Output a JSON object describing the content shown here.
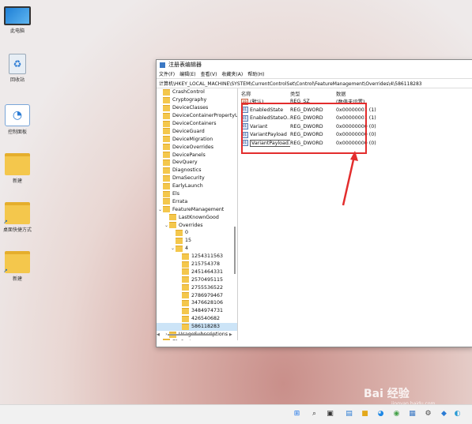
{
  "desktop_icons": [
    {
      "label": "此电脑",
      "kind": "monitor"
    },
    {
      "label": "回收站",
      "kind": "bin"
    },
    {
      "label": "控制面板",
      "kind": "cpanel"
    },
    {
      "label": "新建",
      "kind": "folder"
    },
    {
      "label": "桌面快捷方式",
      "kind": "folder"
    },
    {
      "label": "新建",
      "kind": "folder"
    }
  ],
  "window": {
    "title": "注册表编辑器",
    "menu": [
      "文件(F)",
      "编辑(E)",
      "查看(V)",
      "收藏夹(A)",
      "帮助(H)"
    ],
    "address": "计算机\\HKEY_LOCAL_MACHINE\\SYSTEM\\CurrentControlSet\\Control\\FeatureManagement\\Overrides\\4\\586118283",
    "tree": [
      {
        "label": "CrashControl",
        "indent": 0,
        "chev": ""
      },
      {
        "label": "Cryptography",
        "indent": 0,
        "chev": ""
      },
      {
        "label": "DeviceClasses",
        "indent": 0,
        "chev": ""
      },
      {
        "label": "DeviceContainerPropertyUpdz",
        "indent": 0,
        "chev": ""
      },
      {
        "label": "DeviceContainers",
        "indent": 0,
        "chev": ""
      },
      {
        "label": "DeviceGuard",
        "indent": 0,
        "chev": ""
      },
      {
        "label": "DeviceMigration",
        "indent": 0,
        "chev": ""
      },
      {
        "label": "DeviceOverrides",
        "indent": 0,
        "chev": ""
      },
      {
        "label": "DevicePanels",
        "indent": 0,
        "chev": ""
      },
      {
        "label": "DevQuery",
        "indent": 0,
        "chev": ""
      },
      {
        "label": "Diagnostics",
        "indent": 0,
        "chev": ""
      },
      {
        "label": "DmaSecurity",
        "indent": 0,
        "chev": ""
      },
      {
        "label": "EarlyLaunch",
        "indent": 0,
        "chev": ""
      },
      {
        "label": "Els",
        "indent": 0,
        "chev": ""
      },
      {
        "label": "Errata",
        "indent": 0,
        "chev": ""
      },
      {
        "label": "FeatureManagement",
        "indent": 0,
        "chev": "v"
      },
      {
        "label": "LastKnownGood",
        "indent": 1,
        "chev": ""
      },
      {
        "label": "Overrides",
        "indent": 1,
        "chev": "v"
      },
      {
        "label": "0",
        "indent": 2,
        "chev": ""
      },
      {
        "label": "15",
        "indent": 2,
        "chev": ""
      },
      {
        "label": "4",
        "indent": 2,
        "chev": "v"
      },
      {
        "label": "1254311563",
        "indent": 3,
        "chev": ""
      },
      {
        "label": "215754378",
        "indent": 3,
        "chev": ""
      },
      {
        "label": "2451464331",
        "indent": 3,
        "chev": ""
      },
      {
        "label": "2570495115",
        "indent": 3,
        "chev": ""
      },
      {
        "label": "2755536522",
        "indent": 3,
        "chev": ""
      },
      {
        "label": "2786979467",
        "indent": 3,
        "chev": ""
      },
      {
        "label": "3476628106",
        "indent": 3,
        "chev": ""
      },
      {
        "label": "3484974731",
        "indent": 3,
        "chev": ""
      },
      {
        "label": "426540682",
        "indent": 3,
        "chev": ""
      },
      {
        "label": "586118283",
        "indent": 3,
        "chev": "",
        "selected": true
      },
      {
        "label": "UsageSubscriptions",
        "indent": 1,
        "chev": ">"
      },
      {
        "label": "FileSystem",
        "indent": 0,
        "chev": ">"
      }
    ],
    "columns": [
      "名称",
      "类型",
      "数据"
    ],
    "values": [
      {
        "name": "(默认)",
        "type": "REG_SZ",
        "data": "(数值未设置)",
        "icon": "ab"
      },
      {
        "name": "EnabledState",
        "type": "REG_DWORD",
        "data": "0x00000001 (1)",
        "icon": "bin"
      },
      {
        "name": "EnabledStateO...",
        "type": "REG_DWORD",
        "data": "0x00000001 (1)",
        "icon": "bin"
      },
      {
        "name": "Variant",
        "type": "REG_DWORD",
        "data": "0x00000000 (0)",
        "icon": "bin"
      },
      {
        "name": "VariantPayload",
        "type": "REG_DWORD",
        "data": "0x00000000 (0)",
        "icon": "bin"
      },
      {
        "name": "VariantPayload...",
        "type": "REG_DWORD",
        "data": "0x00000000 (0)",
        "icon": "bin",
        "selected": true
      }
    ]
  },
  "annotation_color": "#e32d2d",
  "watermark": {
    "logo": "Bai 经验",
    "url": "jingyan.baidu.com"
  }
}
